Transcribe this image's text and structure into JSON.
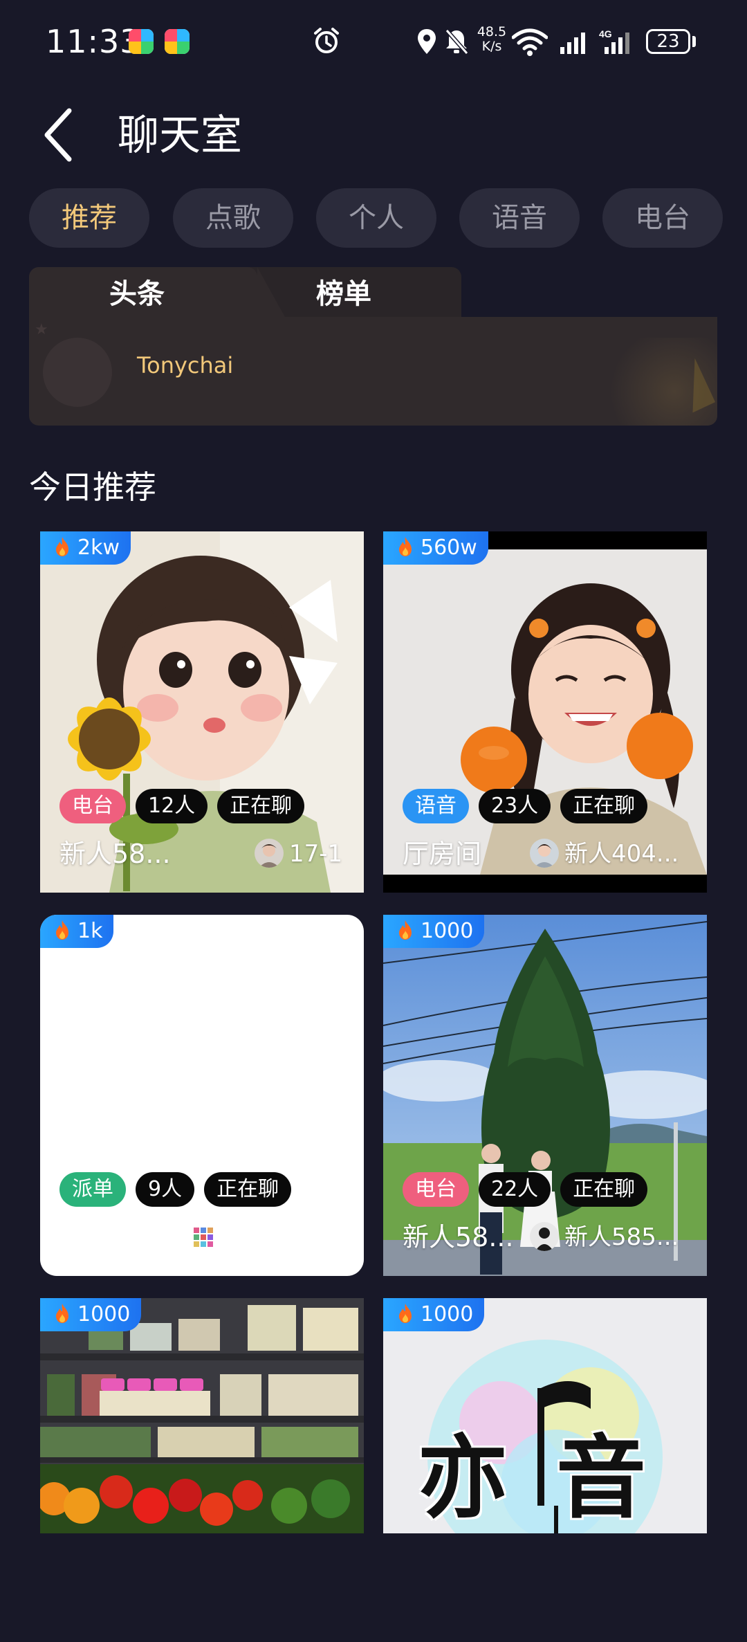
{
  "status_bar": {
    "time": "11:33",
    "net_speed_value": "48.5",
    "net_speed_unit": "K/s",
    "battery": "23",
    "icons": [
      "app-icon",
      "app-icon",
      "alarm-icon",
      "location-icon",
      "mute-bell-icon",
      "wifi-icon",
      "signal-icon",
      "4g-signal-icon",
      "battery-icon"
    ]
  },
  "header": {
    "title": "聊天室"
  },
  "category_tabs": [
    {
      "label": "推荐",
      "active": true
    },
    {
      "label": "点歌",
      "active": false
    },
    {
      "label": "个人",
      "active": false
    },
    {
      "label": "语音",
      "active": false
    },
    {
      "label": "电台",
      "active": false
    }
  ],
  "headline": {
    "tabs": [
      {
        "label": "头条",
        "active": true
      },
      {
        "label": "榜单",
        "active": false
      }
    ],
    "name": "Tonychai"
  },
  "section": {
    "title": "今日推荐"
  },
  "rooms": [
    {
      "hot": "2kw",
      "type": "电台",
      "people": "12人",
      "status": "正在聊",
      "name": "新人58...",
      "host": "17-1"
    },
    {
      "hot": "560w",
      "type": "语音",
      "people": "23人",
      "status": "正在聊",
      "name": "厅房间",
      "host": "新人404..."
    },
    {
      "hot": "1k",
      "type": "派单",
      "people": "9人",
      "status": "正在聊",
      "name": "",
      "host": ""
    },
    {
      "hot": "1000",
      "type": "电台",
      "people": "22人",
      "status": "正在聊",
      "name": "新人58...",
      "host": "新人585..."
    },
    {
      "hot": "1000"
    },
    {
      "hot": "1000",
      "logo_text": "亦音"
    }
  ],
  "colors": {
    "background": "#181828",
    "tab_active_text": "#f2c87a",
    "hot_badge": "#1e72f0",
    "chip_radio": "#ef5f7e",
    "chip_voice": "#2a94f4",
    "chip_order": "#2ab27a"
  }
}
